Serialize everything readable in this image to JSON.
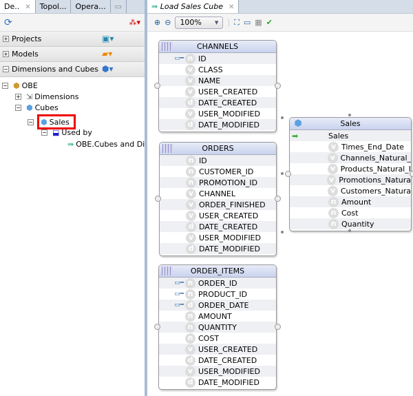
{
  "left": {
    "tabs": [
      "De..",
      "Topol...",
      "Opera..."
    ],
    "accordions": [
      {
        "label": "Projects",
        "expanded": false
      },
      {
        "label": "Models",
        "expanded": false
      },
      {
        "label": "Dimensions and Cubes",
        "expanded": true
      }
    ],
    "tree": {
      "root": "OBE",
      "dimensions": "Dimensions",
      "cubes": "Cubes",
      "sales": "Sales",
      "used_by": "Used by",
      "mapping": "OBE.Cubes and Di"
    }
  },
  "right": {
    "tab": "Load Sales Cube",
    "zoom": "100%"
  },
  "tables": [
    {
      "title": "CHANNELS",
      "cols": [
        [
          "ID",
          "n",
          1
        ],
        [
          "CLASS",
          "v",
          0
        ],
        [
          "NAME",
          "v",
          0
        ],
        [
          "USER_CREATED",
          "v",
          0
        ],
        [
          "DATE_CREATED",
          "d",
          0
        ],
        [
          "USER_MODIFIED",
          "v",
          0
        ],
        [
          "DATE_MODIFIED",
          "d",
          0
        ]
      ]
    },
    {
      "title": "ORDERS",
      "cols": [
        [
          "ID",
          "n",
          0
        ],
        [
          "CUSTOMER_ID",
          "n",
          0
        ],
        [
          "PROMOTION_ID",
          "n",
          0
        ],
        [
          "CHANNEL",
          "v",
          0
        ],
        [
          "ORDER_FINISHED",
          "v",
          0
        ],
        [
          "USER_CREATED",
          "v",
          0
        ],
        [
          "DATE_CREATED",
          "d",
          0
        ],
        [
          "USER_MODIFIED",
          "v",
          0
        ],
        [
          "DATE_MODIFIED",
          "d",
          0
        ]
      ]
    },
    {
      "title": "ORDER_ITEMS",
      "cols": [
        [
          "ORDER_ID",
          "n",
          1
        ],
        [
          "PRODUCT_ID",
          "n",
          1
        ],
        [
          "ORDER_DATE",
          "d",
          1
        ],
        [
          "AMOUNT",
          "n",
          0
        ],
        [
          "QUANTITY",
          "n",
          0
        ],
        [
          "COST",
          "n",
          0
        ],
        [
          "USER_CREATED",
          "v",
          0
        ],
        [
          "DATE_CREATED",
          "d",
          0
        ],
        [
          "USER_MODIFIED",
          "v",
          0
        ],
        [
          "DATE_MODIFIED",
          "d",
          0
        ]
      ]
    },
    {
      "title": "Sales",
      "cube": true,
      "cols": [
        [
          "Sales",
          "",
          2
        ],
        [
          "Times_End_Date",
          "v",
          0
        ],
        [
          "Channels_Natural_",
          "v",
          0
        ],
        [
          "Products_Natural_I",
          "v",
          0
        ],
        [
          "Promotions_Natura",
          "v",
          0
        ],
        [
          "Customers_Natura",
          "v",
          0
        ],
        [
          "Amount",
          "n",
          0
        ],
        [
          "Cost",
          "n",
          0
        ],
        [
          "Quantity",
          "n",
          0
        ]
      ]
    }
  ]
}
